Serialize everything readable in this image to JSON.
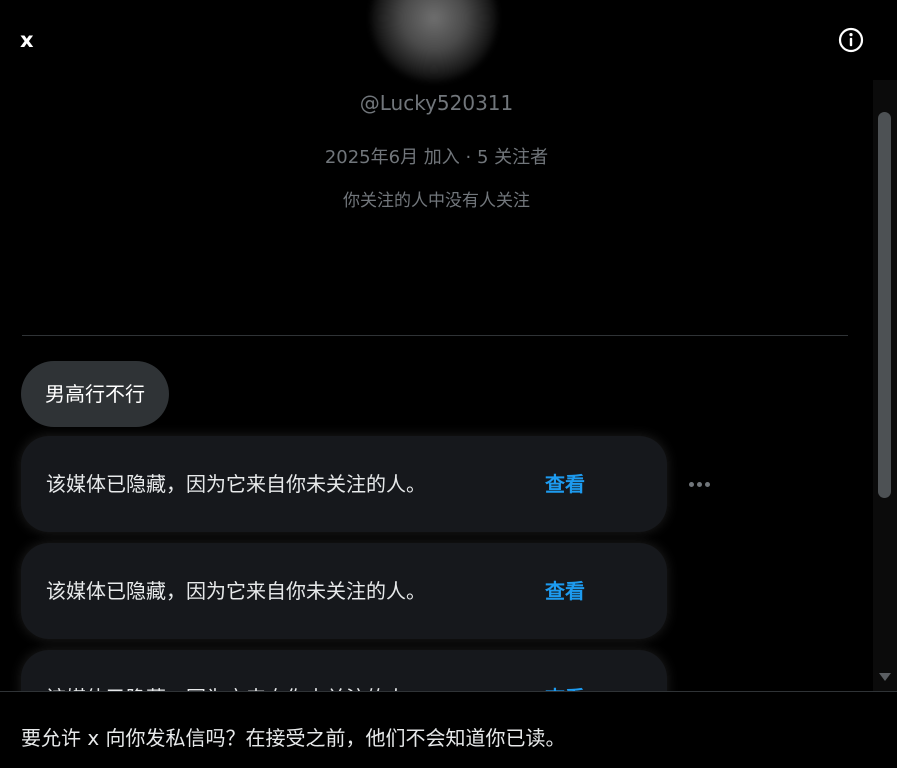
{
  "header": {
    "display_name": "x",
    "info_icon": "info-circle-icon"
  },
  "profile": {
    "handle": "@Lucky520311",
    "meta": "2025年6月 加入 · 5 关注者",
    "mutuals_note": "你关注的人中没有人关注"
  },
  "messages": {
    "text_bubble": "男高行不行",
    "hidden_media": [
      {
        "text": "该媒体已隐藏，因为它来自你未关注的人。",
        "action": "查看"
      },
      {
        "text": "该媒体已隐藏，因为它来自你未关注的人。",
        "action": "查看"
      },
      {
        "text": "该媒体已隐藏，因为它来自你未关注的人。",
        "action": "查看"
      }
    ],
    "more_icon": "more-horizontal-icon"
  },
  "footer": {
    "request_text": "要允许 x 向你发私信吗？在接受之前，他们不会知道你已读。"
  },
  "colors": {
    "background": "#000000",
    "accent": "#1d9bf0",
    "muted_text": "#71767b",
    "card": "#16181c",
    "bubble": "#2f3336"
  }
}
